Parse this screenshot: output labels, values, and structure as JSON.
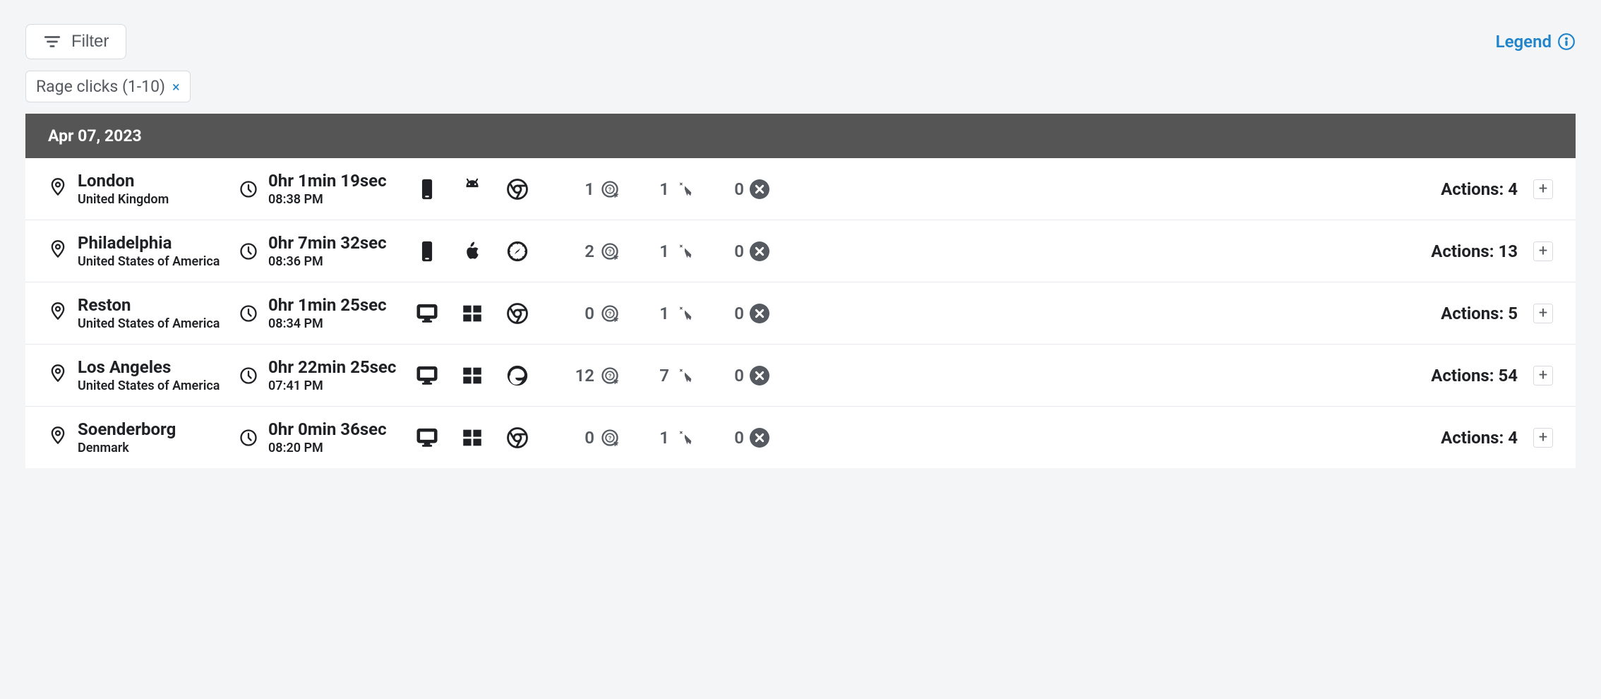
{
  "toolbar": {
    "filter_label": "Filter",
    "legend_label": "Legend"
  },
  "filter_chip": {
    "label": "Rage clicks (1-10)"
  },
  "date_header": "Apr 07, 2023",
  "sessions": [
    {
      "city": "London",
      "country": "United Kingdom",
      "duration": "0hr 1min 19sec",
      "time": "08:38 PM",
      "device": "mobile",
      "os": "android",
      "browser": "chrome",
      "rage": 1,
      "dead": 1,
      "error": 0,
      "actions_label": "Actions: 4",
      "actions": 4
    },
    {
      "city": "Philadelphia",
      "country": "United States of America",
      "duration": "0hr 7min 32sec",
      "time": "08:36 PM",
      "device": "mobile",
      "os": "apple",
      "browser": "safari",
      "rage": 2,
      "dead": 1,
      "error": 0,
      "actions_label": "Actions: 13",
      "actions": 13
    },
    {
      "city": "Reston",
      "country": "United States of America",
      "duration": "0hr 1min 25sec",
      "time": "08:34 PM",
      "device": "desktop",
      "os": "windows",
      "browser": "chrome",
      "rage": 0,
      "dead": 1,
      "error": 0,
      "actions_label": "Actions: 5",
      "actions": 5
    },
    {
      "city": "Los Angeles",
      "country": "United States of America",
      "duration": "0hr 22min 25sec",
      "time": "07:41 PM",
      "device": "desktop",
      "os": "windows",
      "browser": "edge",
      "rage": 12,
      "dead": 7,
      "error": 0,
      "actions_label": "Actions: 54",
      "actions": 54
    },
    {
      "city": "Soenderborg",
      "country": "Denmark",
      "duration": "0hr 0min 36sec",
      "time": "08:20 PM",
      "device": "desktop",
      "os": "windows",
      "browser": "chrome",
      "rage": 0,
      "dead": 1,
      "error": 0,
      "actions_label": "Actions: 4",
      "actions": 4
    }
  ]
}
